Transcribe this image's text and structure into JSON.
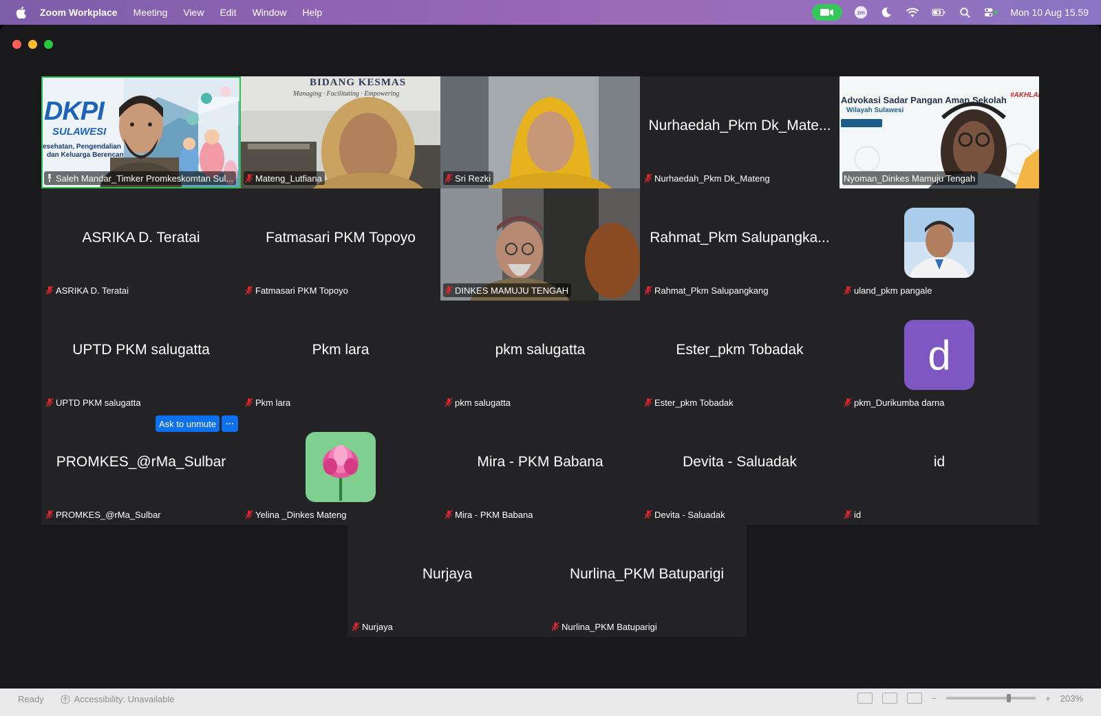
{
  "menubar": {
    "app_name": "Zoom Workplace",
    "menus": [
      "Meeting",
      "View",
      "Edit",
      "Window",
      "Help"
    ],
    "zoom_badge": "zm",
    "clock": "Mon 10 Aug  15.59"
  },
  "tiles": {
    "saleh": {
      "label": "Saleh Mandar_Timker Promkeskomtan Sul...",
      "banner_big": "DKPI",
      "banner_sub": "SULAWESI",
      "banner_line1": "esehatan, Pengendalian",
      "banner_line2": "dan Keluarga Berencan"
    },
    "mateng": {
      "label": "Mateng_Lutfiana",
      "banner_big": "BIDANG KESMAS",
      "banner_sub": "Managing · Facilitating · Empowering"
    },
    "sri": {
      "label": "Sri Rezki"
    },
    "nurhaedah": {
      "name": "Nurhaedah_Pkm Dk_Mate...",
      "label": "Nurhaedah_Pkm Dk_Mateng"
    },
    "nyoman": {
      "label": "Nyoman_Dinkes Mamuju Tengah",
      "slide_title": "Advokasi Sadar Pangan Aman Sekolah",
      "slide_sub": "Wilayah Sulawesi",
      "slide_tag": "#AKHLAK"
    },
    "asrika": {
      "name": "ASRIKA D. Teratai",
      "label": "ASRIKA D. Teratai"
    },
    "fatmasari": {
      "name": "Fatmasari PKM Topoyo",
      "label": "Fatmasari PKM Topoyo"
    },
    "dinkes": {
      "label": "DINKES MAMUJU TENGAH"
    },
    "rahmat": {
      "name": "Rahmat_Pkm Salupangka...",
      "label": "Rahmat_Pkm Salupangkang"
    },
    "uland": {
      "label": "uland_pkm pangale"
    },
    "uptd": {
      "name": "UPTD PKM salugatta",
      "label": "UPTD PKM salugatta"
    },
    "pkmlara": {
      "name": "Pkm lara",
      "label": "Pkm lara"
    },
    "pkmsalugatta": {
      "name": "pkm salugatta",
      "label": "pkm salugatta"
    },
    "ester": {
      "name": "Ester_pkm Tobadak",
      "label": "Ester_pkm Tobadak"
    },
    "durikumba": {
      "avatar_letter": "d",
      "label": "pkm_Durikumba darna"
    },
    "promkes": {
      "name": "PROMKES_@rMa_Sulbar",
      "label": "PROMKES_@rMa_Sulbar"
    },
    "yelina": {
      "label": "Yelina _Dinkes Mateng"
    },
    "mira": {
      "name": "Mira - PKM Babana",
      "label": "Mira - PKM Babana"
    },
    "devita": {
      "name": "Devita - Saluadak",
      "label": "Devita - Saluadak"
    },
    "id": {
      "name": "id",
      "label": "id"
    },
    "nurjaya": {
      "name": "Nurjaya",
      "label": "Nurjaya"
    },
    "nurlina": {
      "name": "Nurlina_PKM Batuparigi",
      "label": "Nurlina_PKM Batuparigi"
    }
  },
  "hover_actions": {
    "ask_unmute": "Ask to unmute",
    "more": "···"
  },
  "status_strip": {
    "ready": "Ready",
    "accessibility": "Accessibility: Unavailable",
    "zoom": "203%"
  },
  "colors": {
    "window_bg": "#19191c",
    "tile_bg": "#232326",
    "active_speaker": "#27c04b",
    "muted_red": "#e0262f",
    "primary_blue": "#0e71eb",
    "avatar_purple": "#7e57c2"
  }
}
